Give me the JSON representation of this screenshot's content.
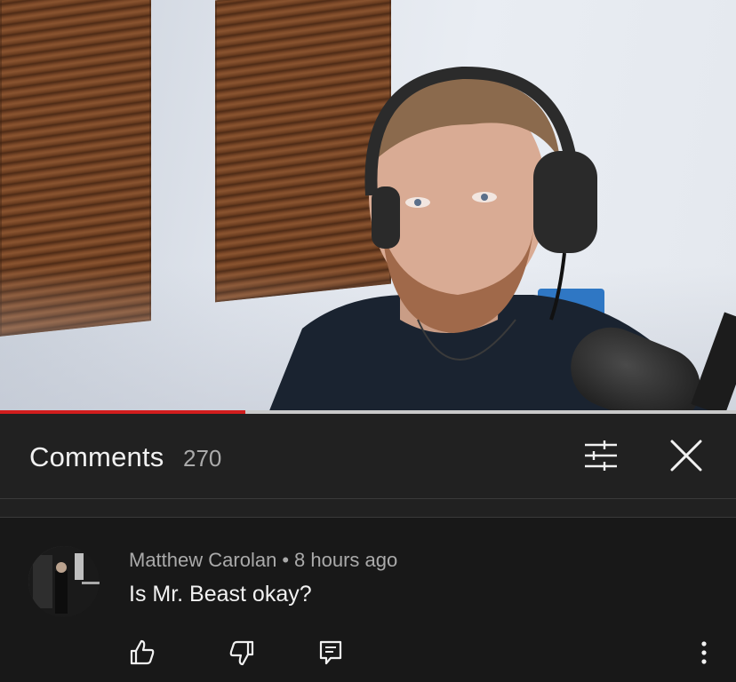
{
  "video": {
    "progress_fraction": 0.333
  },
  "comments_panel": {
    "title": "Comments",
    "count": "270",
    "sort_icon": "sort-filter-icon",
    "close_icon": "close-icon"
  },
  "comment": {
    "author": "Matthew Carolan",
    "separator": "•",
    "time": "8 hours ago",
    "text": "Is Mr. Beast okay?",
    "actions": {
      "like_icon": "thumbs-up-icon",
      "dislike_icon": "thumbs-down-icon",
      "reply_icon": "reply-icon",
      "more_icon": "more-vertical-icon"
    }
  },
  "colors": {
    "panel_bg": "#212121",
    "comment_bg": "#181818",
    "progress_played": "#d11d1d",
    "progress_track": "#c9c9c9",
    "primary_text": "#f1f1f1",
    "secondary_text": "#aaaaaa"
  }
}
